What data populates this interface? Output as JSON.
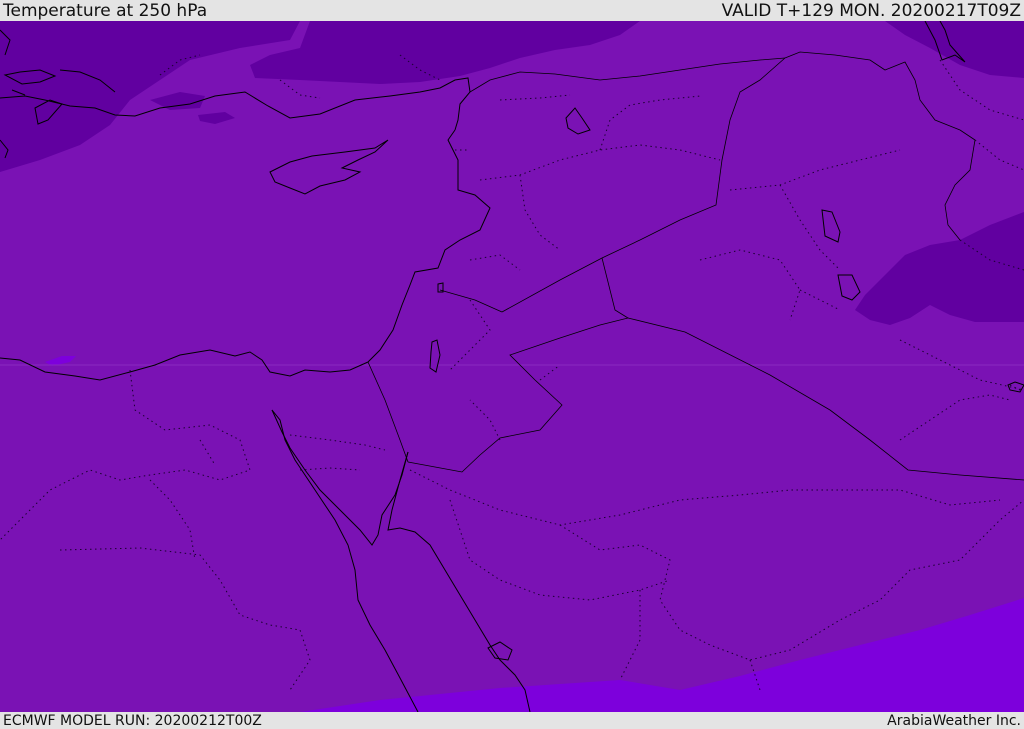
{
  "header": {
    "title": "Temperature at 250 hPa",
    "valid": "VALID T+129 MON. 20200217T09Z"
  },
  "footer": {
    "model_run": "ECMWF MODEL RUN: 20200212T00Z",
    "credit": "ArabiaWeather Inc."
  },
  "colors": {
    "band_warm": "#7a12b4",
    "band_cold": "#6100a0",
    "band_warmest": "#7d00dc",
    "background": "#e4e4e4"
  }
}
